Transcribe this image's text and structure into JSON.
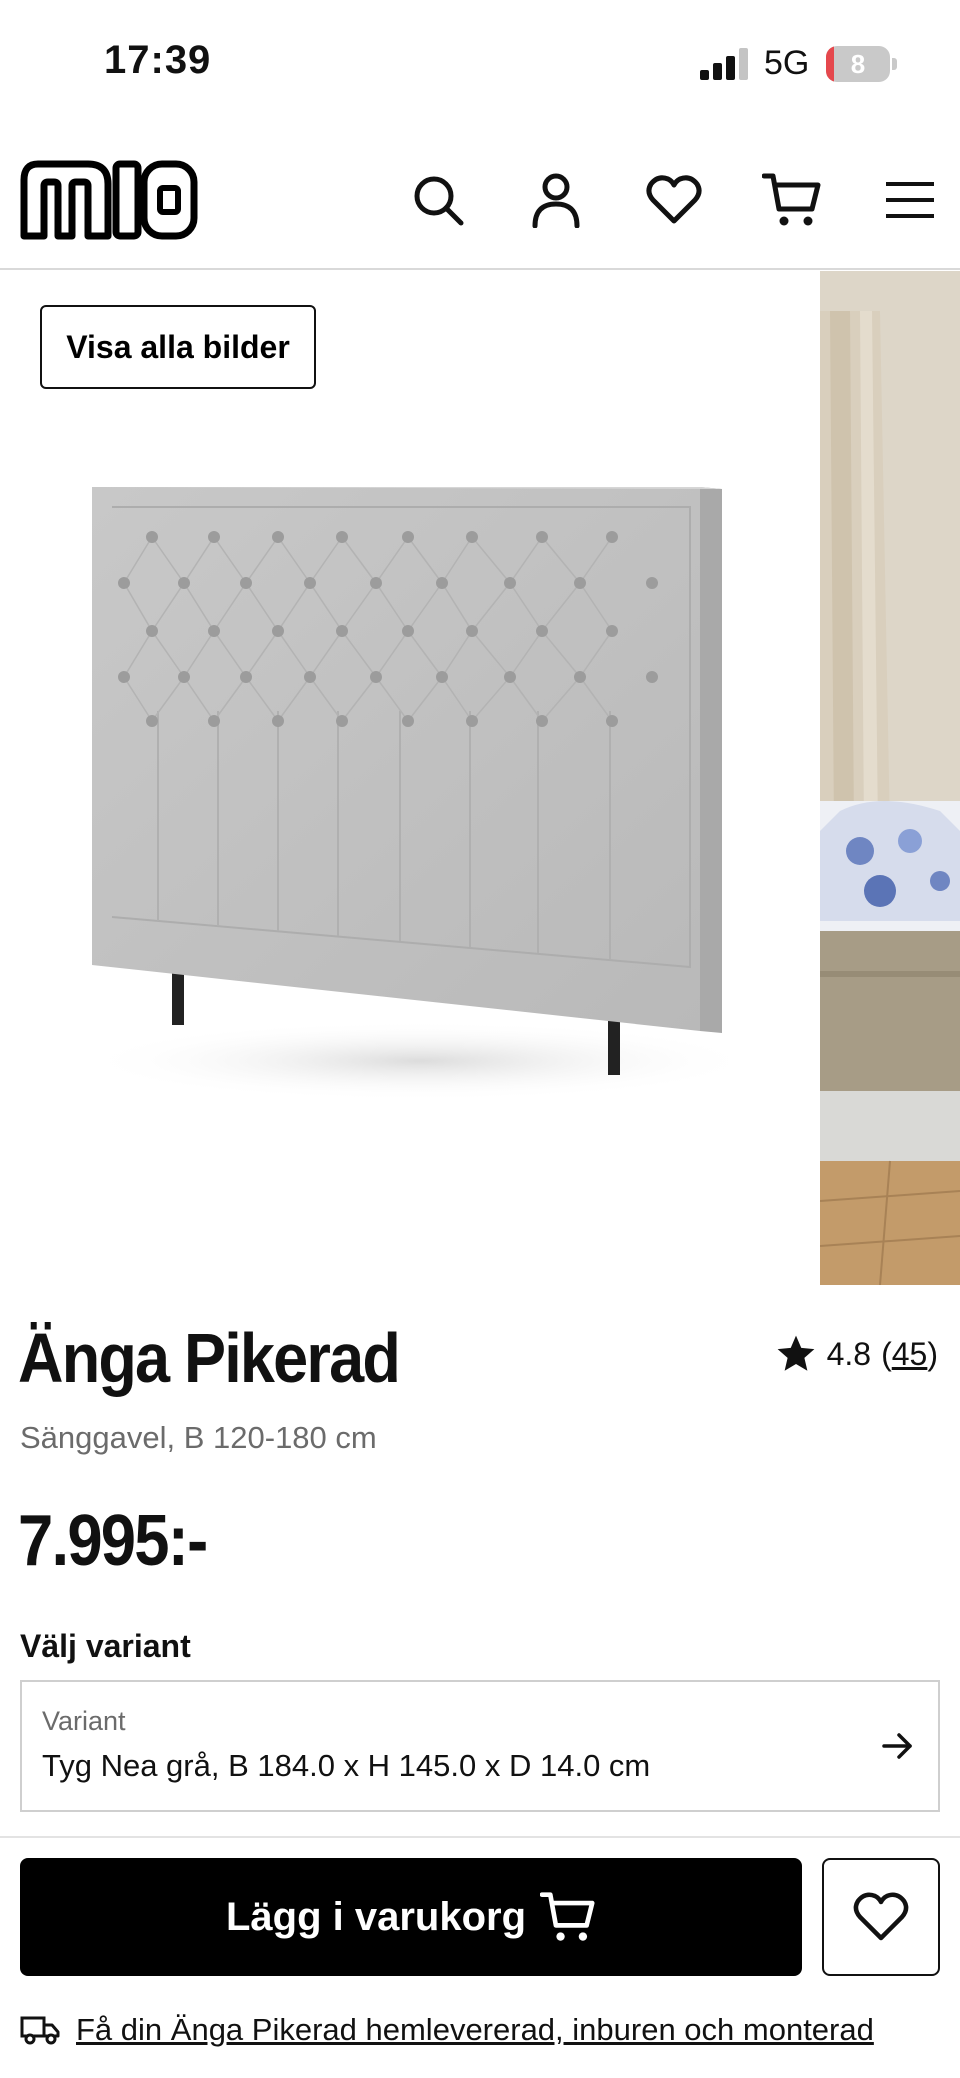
{
  "status_bar": {
    "time": "17:39",
    "network": "5G",
    "battery_level": "8",
    "battery_fraction": 0.08,
    "signal_icon": "signal-bars-icon"
  },
  "header": {
    "logo_text": "mio",
    "icons": [
      "search-icon",
      "account-icon",
      "heart-icon",
      "cart-icon",
      "menu-icon"
    ]
  },
  "gallery": {
    "show_all_label": "Visa alla bilder"
  },
  "product": {
    "title": "Änga Pikerad",
    "subtitle": "Sänggavel, B 120-180 cm",
    "rating": "4.8",
    "rating_open": "(",
    "review_count": "45",
    "rating_close": ")",
    "price": "7.995:-"
  },
  "variant": {
    "heading": "Välj variant",
    "label": "Variant",
    "value": "Tyg Nea grå, B 184.0 x H 145.0 x D 14.0 cm"
  },
  "actions": {
    "add_to_cart_label": "Lägg i varukorg"
  },
  "delivery": {
    "text": "Få din Änga Pikerad hemlevererad, inburen och monterad"
  },
  "colors": {
    "accent": "#000000",
    "battery": "#e5484d",
    "muted_text": "#6b6b6b",
    "border": "#cfcfcf"
  }
}
